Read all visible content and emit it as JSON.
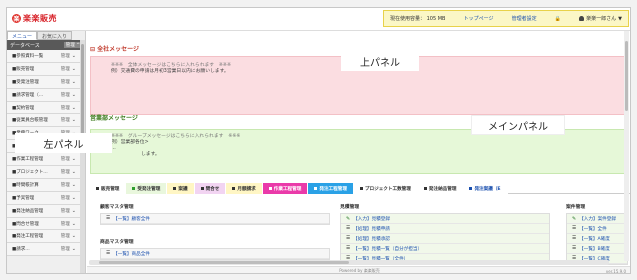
{
  "app": {
    "logo_mark": "楽",
    "logo_text": "楽楽販売"
  },
  "top_panel": {
    "usage": "現在使用容量： 105 MB",
    "top_page": "トップページ",
    "settings": "管理者設定",
    "user": "楽楽一郎さん"
  },
  "callouts": {
    "top": "上パネル",
    "left": "左パネル",
    "main": "メインパネル"
  },
  "left_panel": {
    "tabs": [
      "メニュー",
      "お気に入り"
    ],
    "db_header": "データベース",
    "db_manage": "管理",
    "manage_label": "管理",
    "items": [
      "■参照資料一覧",
      "■販売管理",
      "■受発注管理",
      "■請求管理（…",
      "■契約管理",
      "■従業員台帳管理",
      "■業務ワーク…",
      "■完工案件",
      "■作業工程管理",
      "■プロジェクト…",
      "■時間帳計算",
      "■予実管理",
      "■発注納品管理",
      "■問合せ管理",
      "■発注工程管理",
      "■請求…"
    ]
  },
  "main": {
    "company_title": "全社メッセージ",
    "company_lines": [
      "※※※　全体メッセージはこちらに入れられます　※※※",
      "例）交通費の申請は月初3営業日以内にお願いします。"
    ],
    "dept_title": "営業部メッセージ",
    "dept_lines": [
      "※※※　グループメッセージはこちらに入れられます　※※※",
      "例）営業部各位>",
      "…",
      "します。"
    ],
    "tabs": [
      {
        "label": "販売管理",
        "bg": "#ffffff",
        "sq": "#333333"
      },
      {
        "label": "受発注管理",
        "bg": "#e9f7dd",
        "sq": "#2f9e2f"
      },
      {
        "label": "案議",
        "bg": "#fff6c4",
        "sq": "#333333"
      },
      {
        "label": "問合せ",
        "bg": "#f2d4f2",
        "sq": "#333333"
      },
      {
        "label": "月額請求",
        "bg": "#fff6c4",
        "sq": "#333333"
      },
      {
        "label": "作業工程管理",
        "bg": "#ea3aa9",
        "sq": "#ffffff",
        "fg": "#ffffff"
      },
      {
        "label": "発注工程管理",
        "bg": "#2aa1e6",
        "sq": "#ffffff",
        "fg": "#ffffff"
      },
      {
        "label": "プロジェクト工数管理",
        "bg": "#ffffff",
        "sq": "#333333"
      },
      {
        "label": "発注納品管理",
        "bg": "#ffffff",
        "sq": "#333333"
      },
      {
        "label": "発注案議（E",
        "bg": "#ffffff",
        "sq": "#1a4fae",
        "fg": "#1a4fae"
      }
    ],
    "cards": {
      "customer_title": "顧客マスタ管理",
      "customer_row": "【一覧】顧客全件",
      "product_title": "商品マスタ管理",
      "product_row": "【一覧】商品全件",
      "quote_title": "見積管理",
      "quote_rows": [
        "【入力】見積登録",
        "【処理】見積申請",
        "【処理】見積承認",
        "【一覧】見積一覧（自分が担当）",
        "【一覧】見積一覧（全件）"
      ],
      "deal_title": "案件管理",
      "deal_rows": [
        "【入力】案件登録",
        "【一覧】全件",
        "【一覧】A確度",
        "【一覧】B確度",
        "【一覧】C確度"
      ]
    },
    "footer": "Powered by 楽楽販売",
    "version": "ver.15.9.0"
  }
}
